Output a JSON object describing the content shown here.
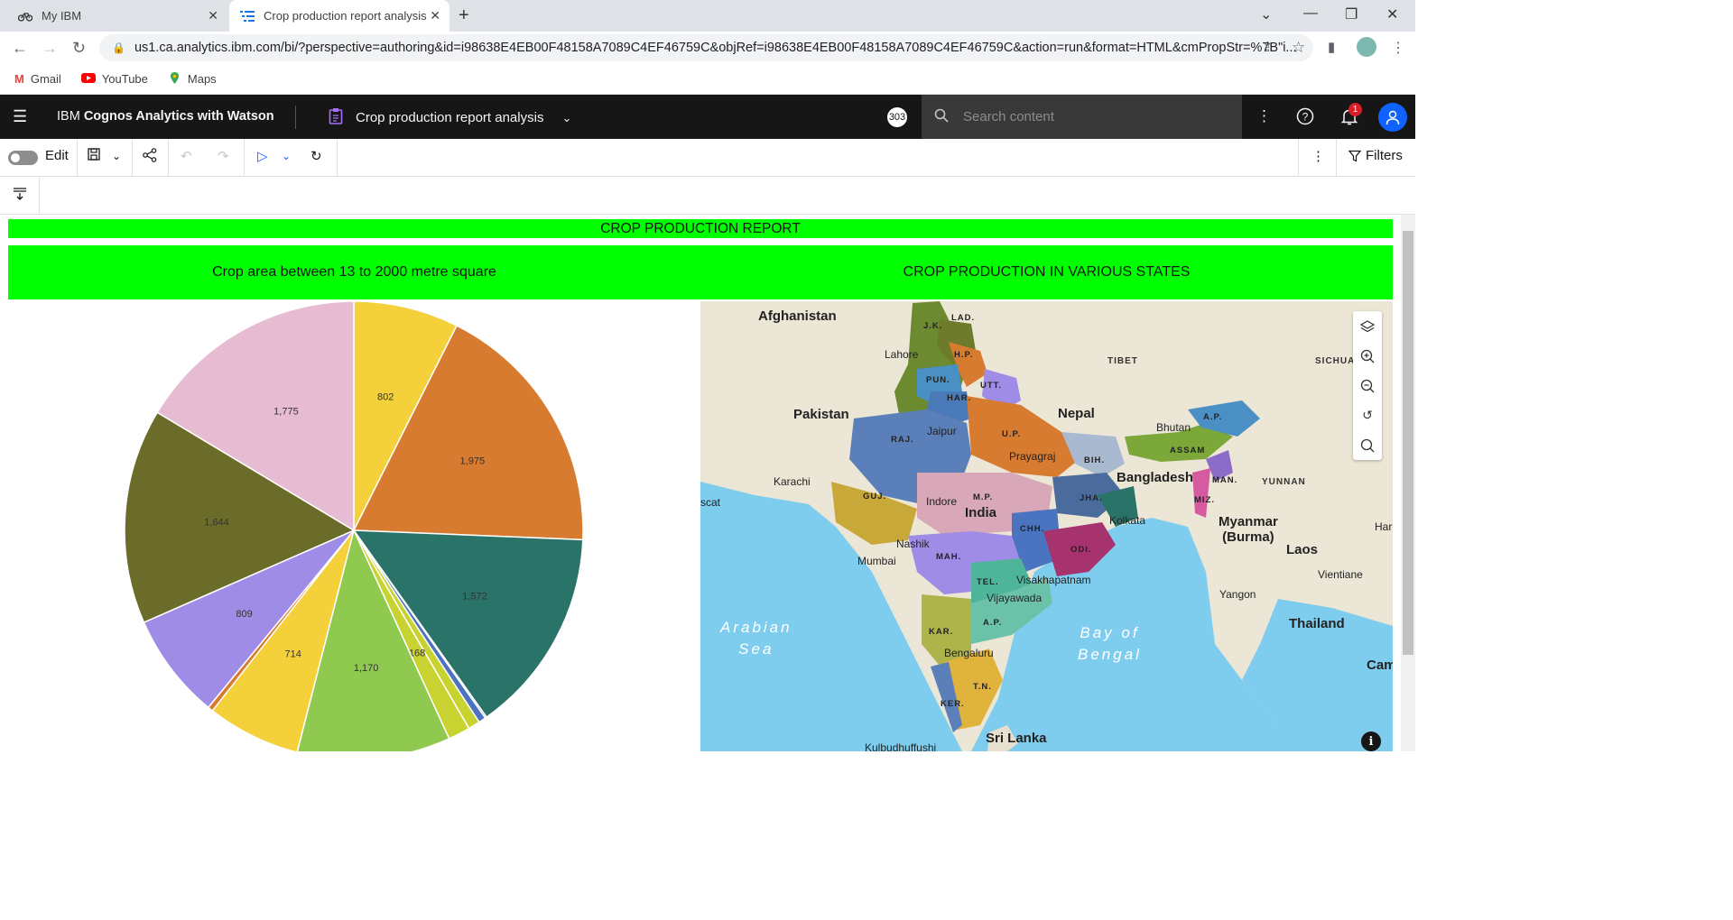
{
  "browser": {
    "tabs": [
      {
        "label": "My IBM",
        "icon": "bicycle-icon",
        "active": false
      },
      {
        "label": "Crop production report analysis",
        "icon": "report-icon",
        "active": true
      }
    ],
    "url": "us1.ca.analytics.ibm.com/bi/?perspective=authoring&id=i98638E4EB00F48158A7089C4EF46759C&objRef=i98638E4EB00F48158A7089C4EF46759C&action=run&format=HTML&cmPropStr=%7B\"i..."
  },
  "bookmarks": [
    {
      "label": "Gmail",
      "color": "#ea4335"
    },
    {
      "label": "YouTube",
      "color": "#ff0000"
    },
    {
      "label": "Maps",
      "color": "#34a853"
    }
  ],
  "appbar": {
    "brand_prefix": "IBM ",
    "brand_name": "Cognos Analytics with Watson",
    "report_title": "Crop production report analysis",
    "count": "303",
    "search_placeholder": "Search content",
    "notification_count": "1"
  },
  "toolbar": {
    "edit_label": "Edit",
    "filters_label": "Filters"
  },
  "report": {
    "title": "CROP PRODUCTION REPORT",
    "left_heading": "Crop area between 13 to 2000 metre square",
    "right_heading": "CROP PRODUCTION IN VARIOUS STATES",
    "banner_color": "#00ff00"
  },
  "chart_data": {
    "type": "pie",
    "slices": [
      {
        "value": 802,
        "label": "802",
        "color": "#f4d03a"
      },
      {
        "value": 1975,
        "label": "1,975",
        "color": "#d67b30"
      },
      {
        "value": 1572,
        "label": "1,572",
        "color": "#2a7368"
      },
      {
        "value": 12,
        "label": "",
        "color": "#1f4e8c"
      },
      {
        "value": 55,
        "label": "",
        "color": "#4b73c0"
      },
      {
        "value": 90,
        "label": "",
        "color": "#c8d230"
      },
      {
        "value": 168,
        "label": "168",
        "color": "#c8d230"
      },
      {
        "value": 1170,
        "label": "1,170",
        "color": "#8fc94f"
      },
      {
        "value": 714,
        "label": "714",
        "color": "#f4d03a"
      },
      {
        "value": 40,
        "label": "",
        "color": "#d67b30"
      },
      {
        "value": 809,
        "label": "809",
        "color": "#9f8ce6"
      },
      {
        "value": 1644,
        "label": "1,644",
        "color": "#6b6b2a"
      },
      {
        "value": 1775,
        "label": "1,775",
        "color": "#e7bcd2"
      }
    ]
  },
  "map": {
    "countries": [
      "Afghanistan",
      "Pakistan",
      "Nepal",
      "Bhutan",
      "Bangladesh",
      "Myanmar\n(Burma)",
      "Laos",
      "Thailand",
      "Sri Lanka",
      "India",
      "TIBET",
      "SICHUA",
      "YUNNAN",
      "Cambo"
    ],
    "cities": [
      "Lahore",
      "Karachi",
      "Jaipur",
      "Prayagraj",
      "Indore",
      "Kolkata",
      "Nashik",
      "Mumbai",
      "Visakhapatnam",
      "Vijayawada",
      "Bengaluru",
      "Yangon",
      "Vientiane",
      "Kulbudhuffushi",
      "scat",
      "Har"
    ],
    "states": [
      "J.K.",
      "LAD.",
      "H.P.",
      "PUN.",
      "UTT.",
      "HAR.",
      "RAJ.",
      "U.P.",
      "BIH.",
      "A.P.",
      "ASSAM",
      "MAN.",
      "MIZ.",
      "GUJ.",
      "M.P.",
      "JHA.",
      "CHH.",
      "ODI.",
      "MAH.",
      "TEL.",
      "A.P.",
      "KAR.",
      "T.N.",
      "KER."
    ],
    "seas": [
      "Arabian\nSea",
      "Bay of\nBengal"
    ],
    "controls": [
      "layers-icon",
      "zoom-in-icon",
      "zoom-out-icon",
      "reset-icon",
      "search-icon"
    ]
  }
}
